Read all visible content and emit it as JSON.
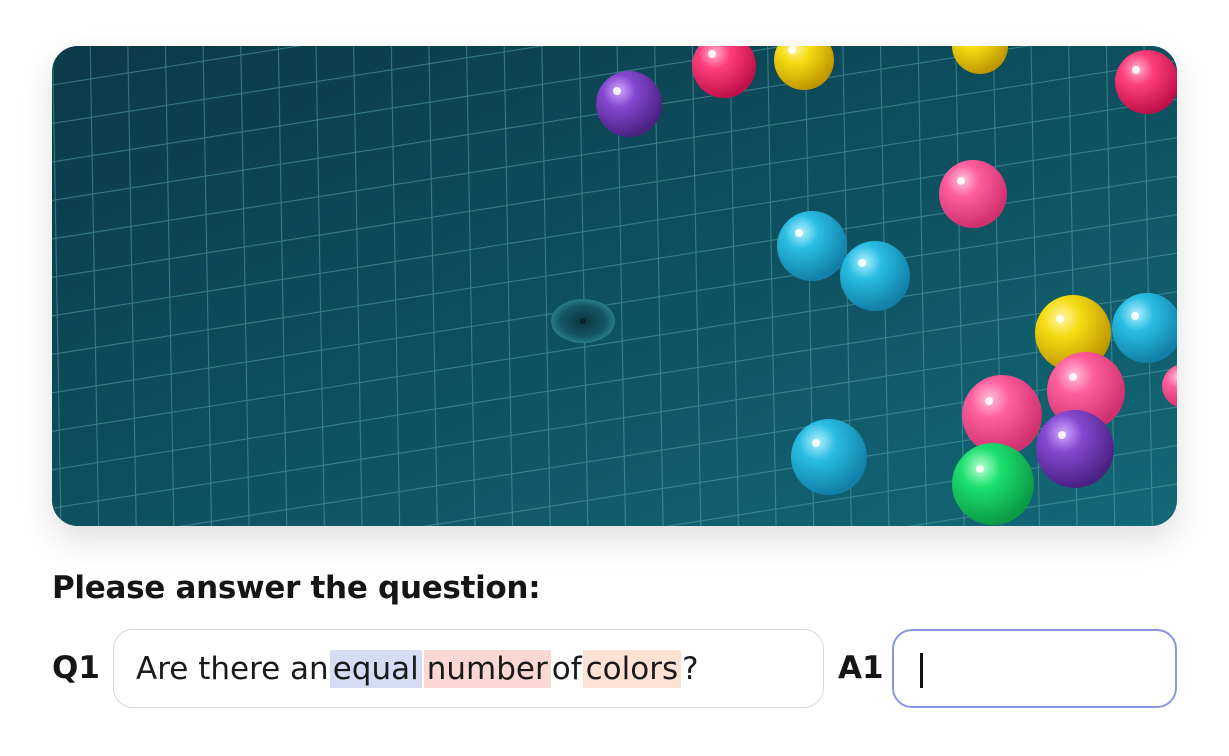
{
  "prompt": "Please answer the question:",
  "question": {
    "label": "Q1",
    "parts": [
      "Are there an ",
      "equal",
      " ",
      "number",
      " of ",
      "colors",
      "?"
    ],
    "highlight_colors": {
      "equal": "#d7dcf5",
      "number": "#fbd8d3",
      "colors": "#fde2d4"
    }
  },
  "answer": {
    "label": "A1",
    "value": ""
  },
  "accent_color": "#8a96e2",
  "image": {
    "subject": "pool-with-floating-balls",
    "water_color": "#0f4d5c",
    "ball_colors": [
      "#ff2f6e",
      "#f5d612",
      "#7f45c8",
      "#ff5f9f",
      "#27c2e6",
      "#17e070"
    ]
  }
}
